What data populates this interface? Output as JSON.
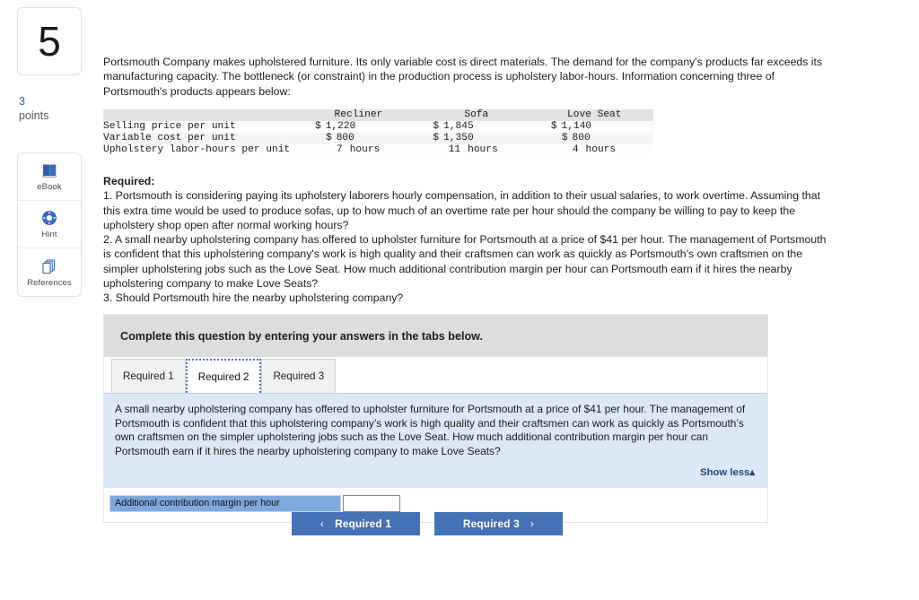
{
  "question": {
    "number": "5",
    "points_value": "3",
    "points_label": "points"
  },
  "tools": [
    {
      "label": "eBook",
      "icon": "book-icon"
    },
    {
      "label": "Hint",
      "icon": "life-ring-icon"
    },
    {
      "label": "References",
      "icon": "stacked-pages-icon"
    }
  ],
  "intro_paragraph": "Portsmouth Company makes upholstered furniture. Its only variable cost is direct materials. The demand for the company's products far exceeds its manufacturing capacity. The bottleneck (or constraint) in the production process is upholstery labor-hours. Information concerning three of Portsmouth's products appears below:",
  "table": {
    "columns": [
      "",
      "Recliner",
      "Sofa",
      "Love Seat"
    ],
    "rows": [
      {
        "label": "Selling price per unit",
        "cells": [
          {
            "symbol": "$",
            "amount": "1,220"
          },
          {
            "symbol": "$",
            "amount": "1,845"
          },
          {
            "symbol": "$",
            "amount": "1,140"
          }
        ]
      },
      {
        "label": "Variable cost per unit",
        "cells": [
          {
            "symbol": "$",
            "amount": "800"
          },
          {
            "symbol": "$",
            "amount": "1,350"
          },
          {
            "symbol": "$",
            "amount": "800"
          }
        ]
      },
      {
        "label": "Upholstery labor-hours per unit",
        "cells": [
          {
            "hours": "7",
            "unit": "hours"
          },
          {
            "hours": "11",
            "unit": "hours"
          },
          {
            "hours": "4",
            "unit": "hours"
          }
        ]
      }
    ]
  },
  "required": {
    "title": "Required:",
    "item1": "1. Portsmouth is considering paying its upholstery laborers hourly compensation, in addition to their usual salaries, to work overtime. Assuming that this extra time would be used to produce sofas, up to how much of an overtime rate per hour should the company be willing to pay to keep the upholstery shop open after normal working hours?",
    "item2": "2.  A small nearby upholstering company has offered to upholster furniture for Portsmouth at a price of $41 per hour. The management of Portsmouth is confident that this upholstering company's work is high quality and their craftsmen can work as quickly as Portsmouth's own craftsmen on the simpler upholstering jobs such as the Love Seat. How much additional contribution margin per hour can Portsmouth earn if it hires the nearby upholstering company to make Love Seats?",
    "item3": "3. Should Portsmouth hire the nearby upholstering company?"
  },
  "card": {
    "complete_bar_text": "Complete this question by entering your answers in the tabs below.",
    "tabs": [
      {
        "label": "Required 1",
        "active": false
      },
      {
        "label": "Required 2",
        "active": true
      },
      {
        "label": "Required 3",
        "active": false
      }
    ],
    "info_text": "A small nearby upholstering company has offered to upholster furniture for Portsmouth at a price of $41 per hour. The management of Portsmouth is confident that this upholstering company’s work is high quality and their craftsmen can work as quickly as Portsmouth’s own craftsmen on the simpler upholstering jobs such as the Love Seat. How much additional contribution margin per hour can Portsmouth earn if it hires the nearby upholstering company to make Love Seats?",
    "show_less_label": "Show less▴",
    "answer_label": "Additional contribution margin per hour",
    "answer_value": "",
    "answer_placeholder": ""
  },
  "nav": {
    "prev_label": "Required 1",
    "prev_chevron": "‹",
    "next_label": "Required 3",
    "next_chevron": "›"
  },
  "colors": {
    "button_blue": "#4572b5",
    "label_blue": "#7fa8dd",
    "info_blue": "#dce8f5",
    "bar_gray": "#dddddd",
    "link_blue": "#24487e",
    "points_blue": "#2e5fa3"
  }
}
